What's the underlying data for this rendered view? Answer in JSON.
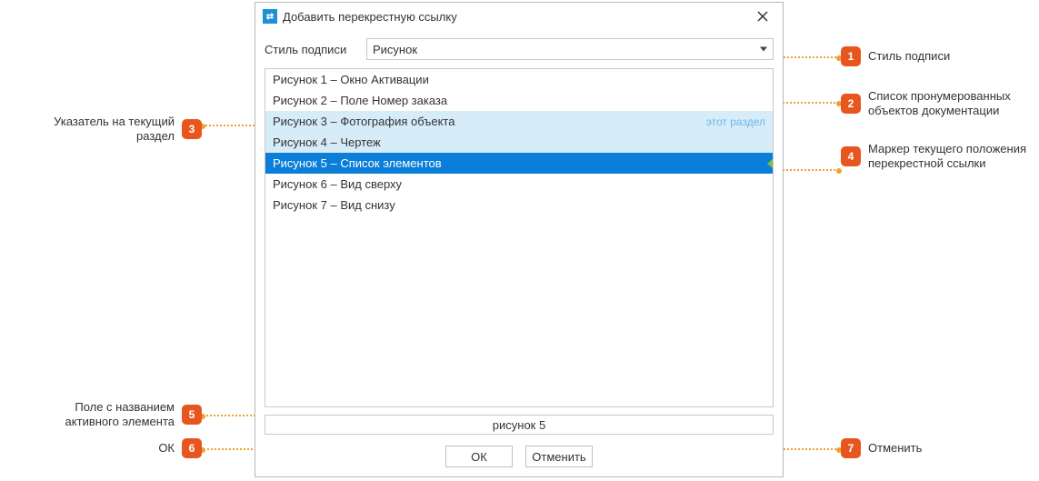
{
  "dialog": {
    "title": "Добавить перекрестную ссылку",
    "style_label": "Стиль подписи",
    "style_value": "Рисунок",
    "items": [
      "Рисунок 1 – Окно Активации",
      "Рисунок 2 – Поле Номер заказа",
      "Рисунок 3 – Фотография объекта",
      "Рисунок 4 – Чертеж",
      "Рисунок 5 – Список элементов",
      "Рисунок 6 – Вид сверху",
      "Рисунок 7 – Вид снизу"
    ],
    "section_tag": "этот раздел",
    "active_value": "рисунок 5",
    "ok_label": "ОК",
    "cancel_label": "Отменить"
  },
  "callouts": {
    "c1": "Стиль подписи",
    "c2": "Список пронумерованных объектов документации",
    "c3": "Указатель на текущий раздел",
    "c4": "Маркер текущего положения перекрестной ссылки",
    "c5": "Поле с названием активного элемента",
    "c6": "ОК",
    "c7": "Отменить"
  }
}
